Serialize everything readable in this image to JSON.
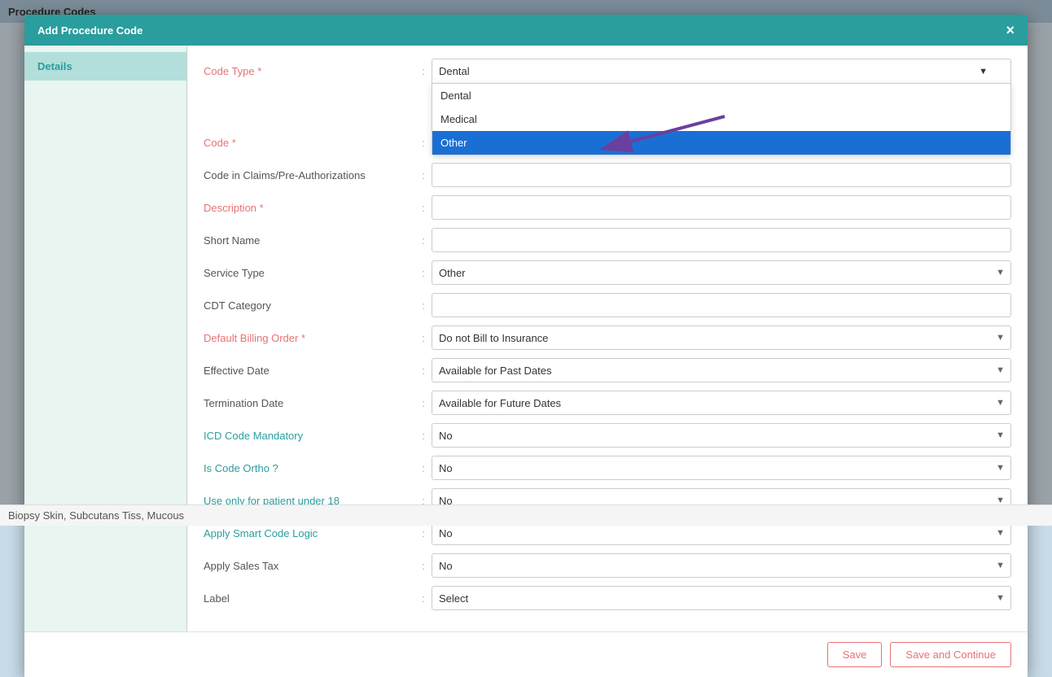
{
  "page": {
    "title": "Procedure Codes",
    "bg_row_text": "Biopsy Skin, Subcutans Tiss, Mucous"
  },
  "modal": {
    "title": "Add Procedure Code",
    "close_label": "×",
    "sidebar": {
      "items": [
        {
          "label": "Details",
          "active": true
        }
      ]
    },
    "form": {
      "fields": [
        {
          "label": "Code Type",
          "required": true,
          "type": "dropdown_open",
          "value": "Dental",
          "id": "code-type"
        },
        {
          "label": "Code",
          "required": true,
          "type": "input",
          "value": "",
          "id": "code"
        },
        {
          "label": "Code in Claims/Pre-Authorizations",
          "required": false,
          "type": "input",
          "value": "",
          "id": "claims-code"
        },
        {
          "label": "Description",
          "required": true,
          "type": "input",
          "value": "",
          "id": "description"
        },
        {
          "label": "Short Name",
          "required": false,
          "type": "input",
          "value": "",
          "id": "short-name"
        },
        {
          "label": "Service Type",
          "required": false,
          "type": "select",
          "value": "Other",
          "id": "service-type"
        },
        {
          "label": "CDT Category",
          "required": false,
          "type": "input",
          "value": "",
          "id": "cdt-category"
        },
        {
          "label": "Default Billing Order",
          "required": true,
          "type": "select",
          "value": "Do not Bill to Insurance",
          "id": "billing-order"
        },
        {
          "label": "Effective Date",
          "required": false,
          "type": "select",
          "value": "Available for Past Dates",
          "id": "effective-date"
        },
        {
          "label": "Termination Date",
          "required": false,
          "type": "select",
          "value": "Available for Future Dates",
          "id": "termination-date"
        },
        {
          "label": "ICD Code Mandatory",
          "required": false,
          "type": "select",
          "value": "No",
          "id": "icd-mandatory"
        },
        {
          "label": "Is Code Ortho ?",
          "required": false,
          "type": "select",
          "value": "No",
          "id": "is-ortho"
        },
        {
          "label": "Use only for patient under 18",
          "required": false,
          "type": "select",
          "value": "No",
          "id": "under-18"
        },
        {
          "label": "Apply Smart Code Logic",
          "required": false,
          "type": "select",
          "value": "No",
          "id": "smart-code"
        },
        {
          "label": "Apply Sales Tax",
          "required": false,
          "type": "select",
          "value": "No",
          "id": "sales-tax"
        },
        {
          "label": "Label",
          "required": false,
          "type": "select",
          "value": "Select",
          "id": "label"
        }
      ],
      "code_type_options": [
        {
          "label": "Dental",
          "selected": false
        },
        {
          "label": "Medical",
          "selected": false
        },
        {
          "label": "Other",
          "selected": true
        }
      ]
    },
    "footer": {
      "save_label": "Save",
      "save_continue_label": "Save and Continue"
    }
  },
  "colors": {
    "teal": "#2a9d9e",
    "selected_blue": "#1a6fd4",
    "required_red": "#e57373",
    "arrow_purple": "#6b3fa0"
  }
}
